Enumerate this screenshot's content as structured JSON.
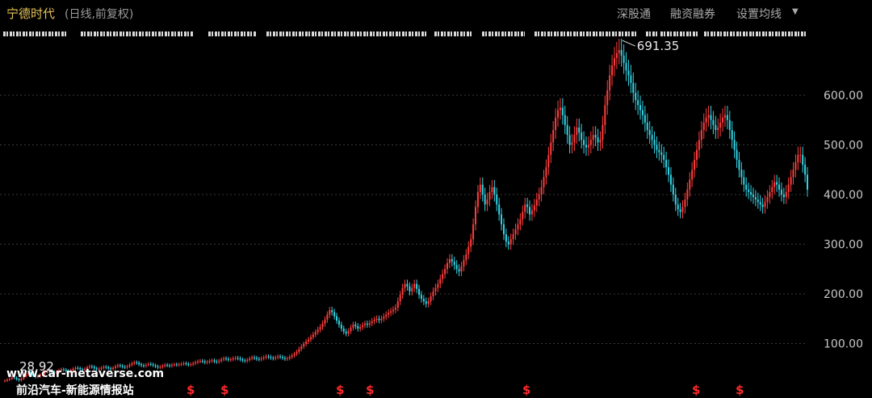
{
  "header": {
    "title": "宁德时代",
    "subtitle": "(日线,前复权)",
    "menu": [
      "深股通",
      "融资融券",
      "设置均线"
    ]
  },
  "chart_data": {
    "type": "candlestick",
    "ylim": [
      0,
      720
    ],
    "y_ticks": [
      100,
      200,
      300,
      400,
      500,
      600
    ],
    "y_tick_labels": [
      "100.00",
      "200.00",
      "300.00",
      "400.00",
      "500.00",
      "600.00"
    ],
    "grid": true,
    "annotations": {
      "high": "691.35",
      "low": "28.92"
    },
    "colors": {
      "up": "#ff3d3d",
      "down": "#33d4e6",
      "grid": "#3a3a3a",
      "tick": "#c8c8c8",
      "marker": "#ff2a2a"
    },
    "closes": [
      25,
      27,
      29,
      32,
      31,
      28,
      26,
      29,
      34,
      38,
      42,
      40,
      36,
      33,
      34,
      37,
      40,
      43,
      45,
      44,
      42,
      41,
      43,
      46,
      48,
      47,
      45,
      44,
      46,
      49,
      51,
      50,
      48,
      47,
      49,
      52,
      54,
      53,
      50,
      48,
      49,
      51,
      53,
      52,
      50,
      49,
      51,
      54,
      56,
      55,
      53,
      52,
      54,
      57,
      60,
      62,
      61,
      58,
      56,
      55,
      57,
      59,
      58,
      56,
      54,
      52,
      53,
      55,
      57,
      56,
      55,
      57,
      58,
      57,
      58,
      59,
      60,
      59,
      57,
      58,
      60,
      62,
      64,
      65,
      64,
      62,
      63,
      65,
      66,
      64,
      63,
      65,
      68,
      70,
      69,
      67,
      68,
      70,
      71,
      70,
      68,
      66,
      65,
      67,
      70,
      72,
      71,
      69,
      68,
      70,
      72,
      74,
      73,
      71,
      70,
      72,
      74,
      73,
      71,
      69,
      70,
      73,
      76,
      79,
      83,
      89,
      94,
      99,
      104,
      108,
      113,
      118,
      123,
      128,
      133,
      140,
      148,
      158,
      167,
      163,
      155,
      146,
      138,
      130,
      124,
      120,
      125,
      132,
      138,
      135,
      130,
      133,
      137,
      140,
      138,
      141,
      145,
      148,
      150,
      147,
      150,
      154,
      158,
      162,
      165,
      168,
      172,
      185,
      198,
      212,
      220,
      215,
      205,
      212,
      220,
      210,
      198,
      190,
      185,
      180,
      185,
      195,
      205,
      212,
      220,
      230,
      240,
      250,
      262,
      270,
      265,
      258,
      250,
      245,
      255,
      268,
      280,
      295,
      310,
      340,
      375,
      405,
      420,
      400,
      380,
      390,
      405,
      415,
      400,
      380,
      360,
      340,
      320,
      305,
      300,
      310,
      320,
      330,
      340,
      350,
      365,
      380,
      375,
      360,
      368,
      378,
      390,
      400,
      415,
      435,
      455,
      480,
      505,
      530,
      555,
      570,
      575,
      560,
      540,
      520,
      500,
      505,
      520,
      535,
      525,
      510,
      500,
      495,
      500,
      510,
      520,
      515,
      505,
      510,
      540,
      580,
      610,
      640,
      660,
      675,
      685,
      691,
      680,
      665,
      650,
      640,
      625,
      605,
      590,
      580,
      570,
      560,
      545,
      530,
      520,
      510,
      500,
      490,
      485,
      480,
      470,
      455,
      440,
      420,
      400,
      380,
      370,
      365,
      375,
      390,
      410,
      430,
      450,
      470,
      490,
      510,
      530,
      545,
      555,
      560,
      550,
      540,
      530,
      535,
      545,
      555,
      560,
      550,
      530,
      510,
      490,
      470,
      450,
      435,
      420,
      410,
      405,
      400,
      395,
      390,
      385,
      380,
      375,
      385,
      395,
      405,
      415,
      425,
      420,
      410,
      400,
      395,
      405,
      420,
      435,
      450,
      465,
      480,
      480,
      460,
      440,
      410
    ]
  },
  "markers": {
    "glyph": "$",
    "x": [
      236,
      278,
      421,
      458,
      652,
      862,
      916
    ]
  },
  "watermark": {
    "line1": "www.car-metaverse.com",
    "line2": "前沿汽车-新能源情报站"
  }
}
